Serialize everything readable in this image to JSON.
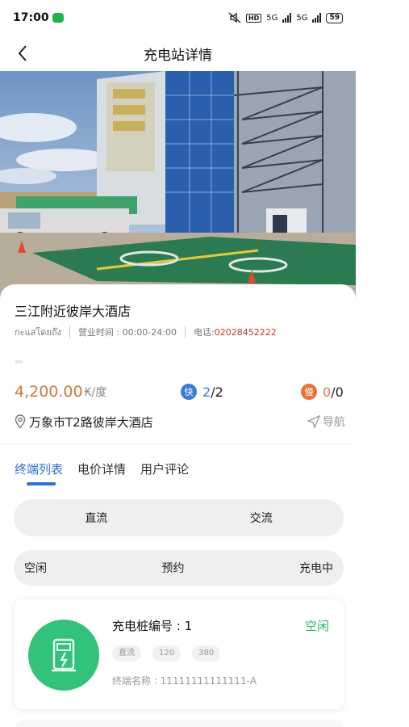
{
  "status_bar": {
    "time": "17:00",
    "net1": "5G",
    "net2": "5G",
    "hd": "HD",
    "battery": "59"
  },
  "nav": {
    "title": "充电站详情",
    "back_icon": "chevron-left-icon"
  },
  "station": {
    "name": "三江附近彼岸大酒店",
    "operator": "กะแสโดยถ๊ง",
    "hours_label": "营业时间 : 00:00-24:00",
    "phone_label": "电话:",
    "phone": "02028452222",
    "price": "4,200.00",
    "price_unit": "₭/度",
    "fast_badge": "快",
    "fast_available": "2",
    "fast_total": "/2",
    "slow_badge": "慢",
    "slow_available": "0",
    "slow_total": "/0",
    "address": "万象市T2路彼岸大酒店",
    "navigate_label": "导航"
  },
  "tabs": [
    {
      "label": "终端列表",
      "active": true
    },
    {
      "label": "电价详情",
      "active": false
    },
    {
      "label": "用户评论",
      "active": false
    }
  ],
  "current_type_options": [
    "直流",
    "交流"
  ],
  "status_options": [
    "空闲",
    "预约",
    "充电中"
  ],
  "pile": {
    "number_label": "充电桩编号 : 1",
    "status": "空闲",
    "tags": [
      "直流",
      "120",
      "380"
    ],
    "terminal_label": "终端名称 : 11111111111111-A"
  },
  "colors": {
    "accent_blue": "#2f6fd6",
    "price_orange": "#d3753a",
    "free_green": "#2fb36f",
    "phone_red": "#c0392b"
  }
}
